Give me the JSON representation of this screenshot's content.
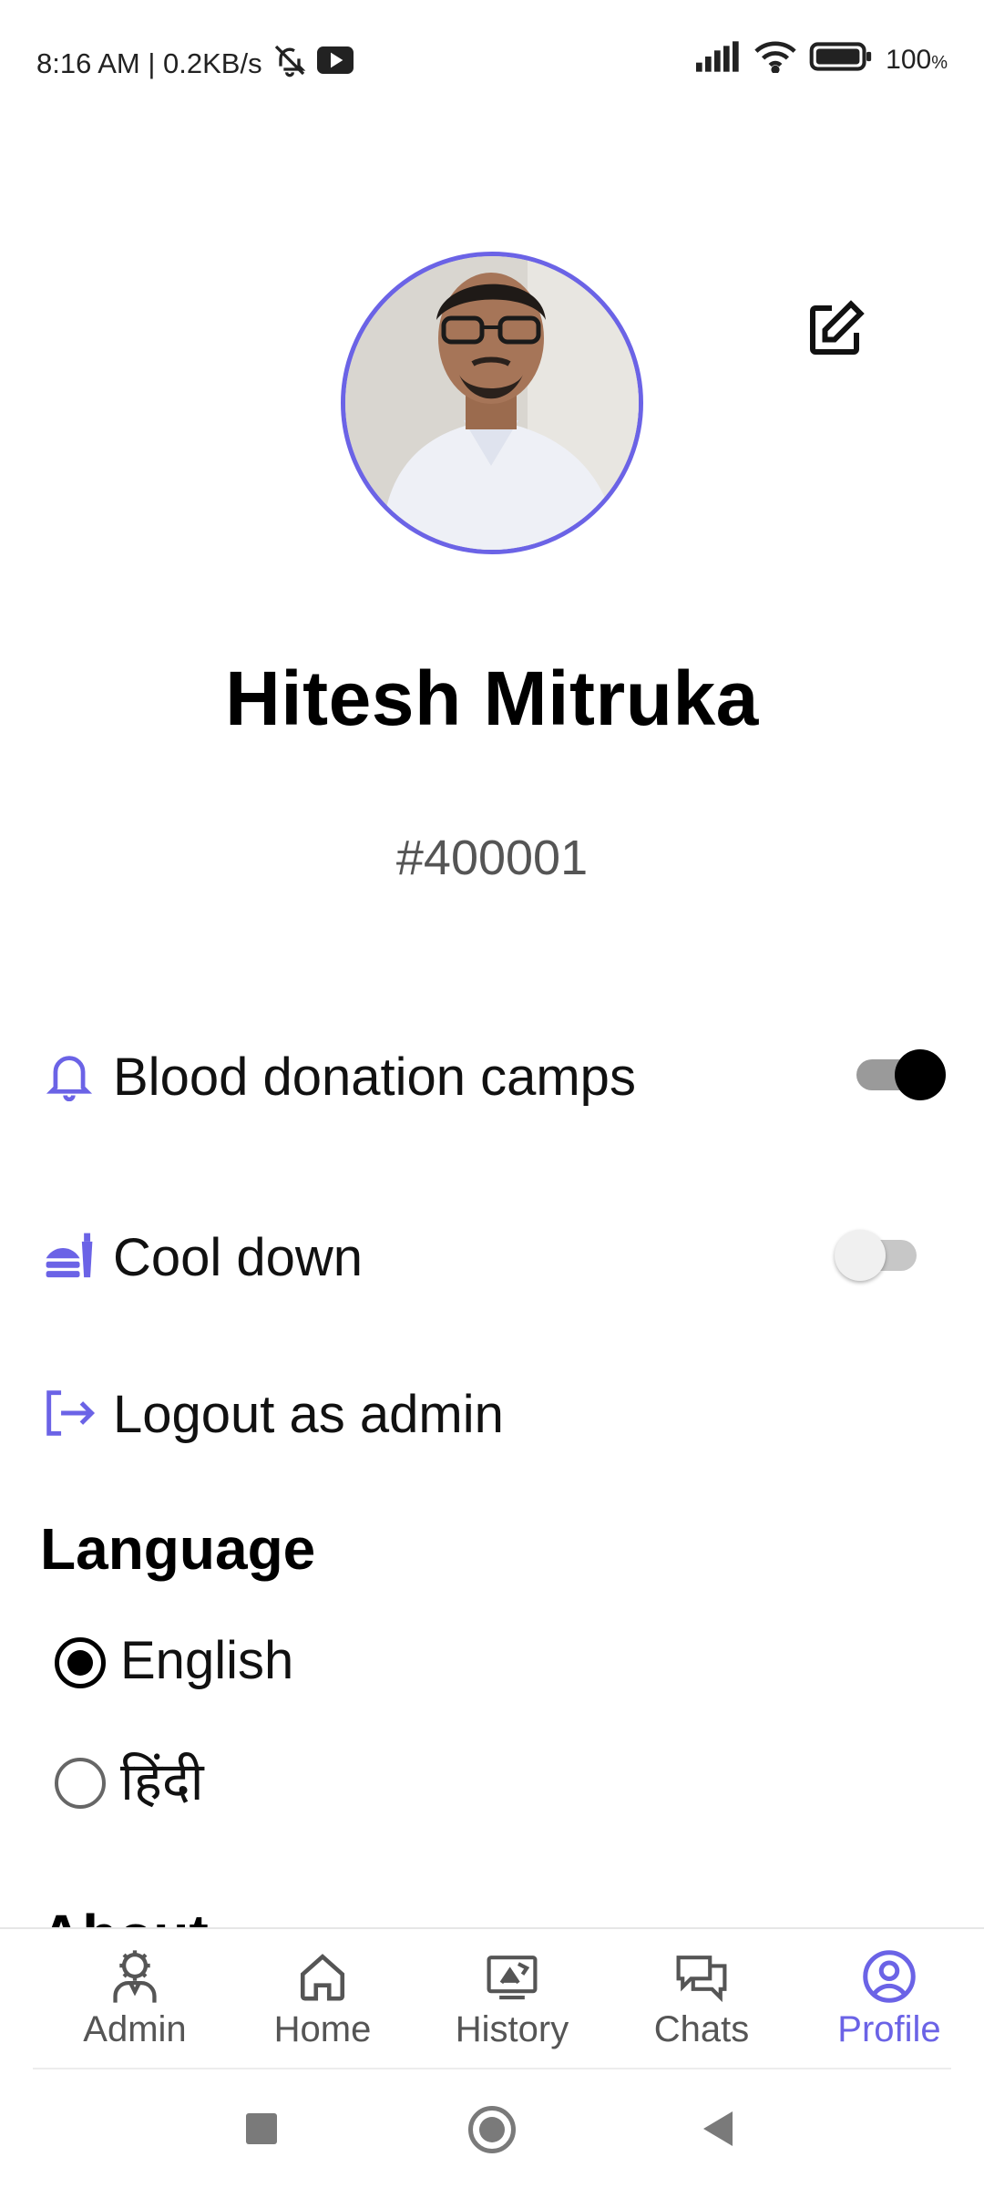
{
  "status_bar": {
    "time_speed": "8:16 AM | 0.2KB/s",
    "battery": "100",
    "battery_unit": "%"
  },
  "profile": {
    "name": "Hitesh Mitruka",
    "user_id": "#400001"
  },
  "settings": [
    {
      "label": "Blood donation camps",
      "icon": "bell-icon",
      "toggle_on": true
    },
    {
      "label": "Cool down",
      "icon": "cooldown-icon",
      "toggle_on": false
    },
    {
      "label": "Logout as admin",
      "icon": "logout-icon"
    }
  ],
  "language": {
    "title": "Language",
    "options": [
      {
        "label": "English",
        "selected": true
      },
      {
        "label": "हिंदी",
        "selected": false
      }
    ]
  },
  "about_heading": "About",
  "bottom_nav": {
    "items": [
      {
        "label": "Admin",
        "icon": "admin-icon",
        "active": false
      },
      {
        "label": "Home",
        "icon": "home-icon",
        "active": false
      },
      {
        "label": "History",
        "icon": "history-icon",
        "active": false
      },
      {
        "label": "Chats",
        "icon": "chats-icon",
        "active": false
      },
      {
        "label": "Profile",
        "icon": "profile-icon",
        "active": true
      }
    ]
  },
  "colors": {
    "accent": "#6b63e6",
    "toggle_on_thumb": "#000000",
    "toggle_on_track": "#9a9a9a",
    "toggle_off_thumb": "#f0f0f0",
    "toggle_off_track": "#c7c7c7"
  }
}
